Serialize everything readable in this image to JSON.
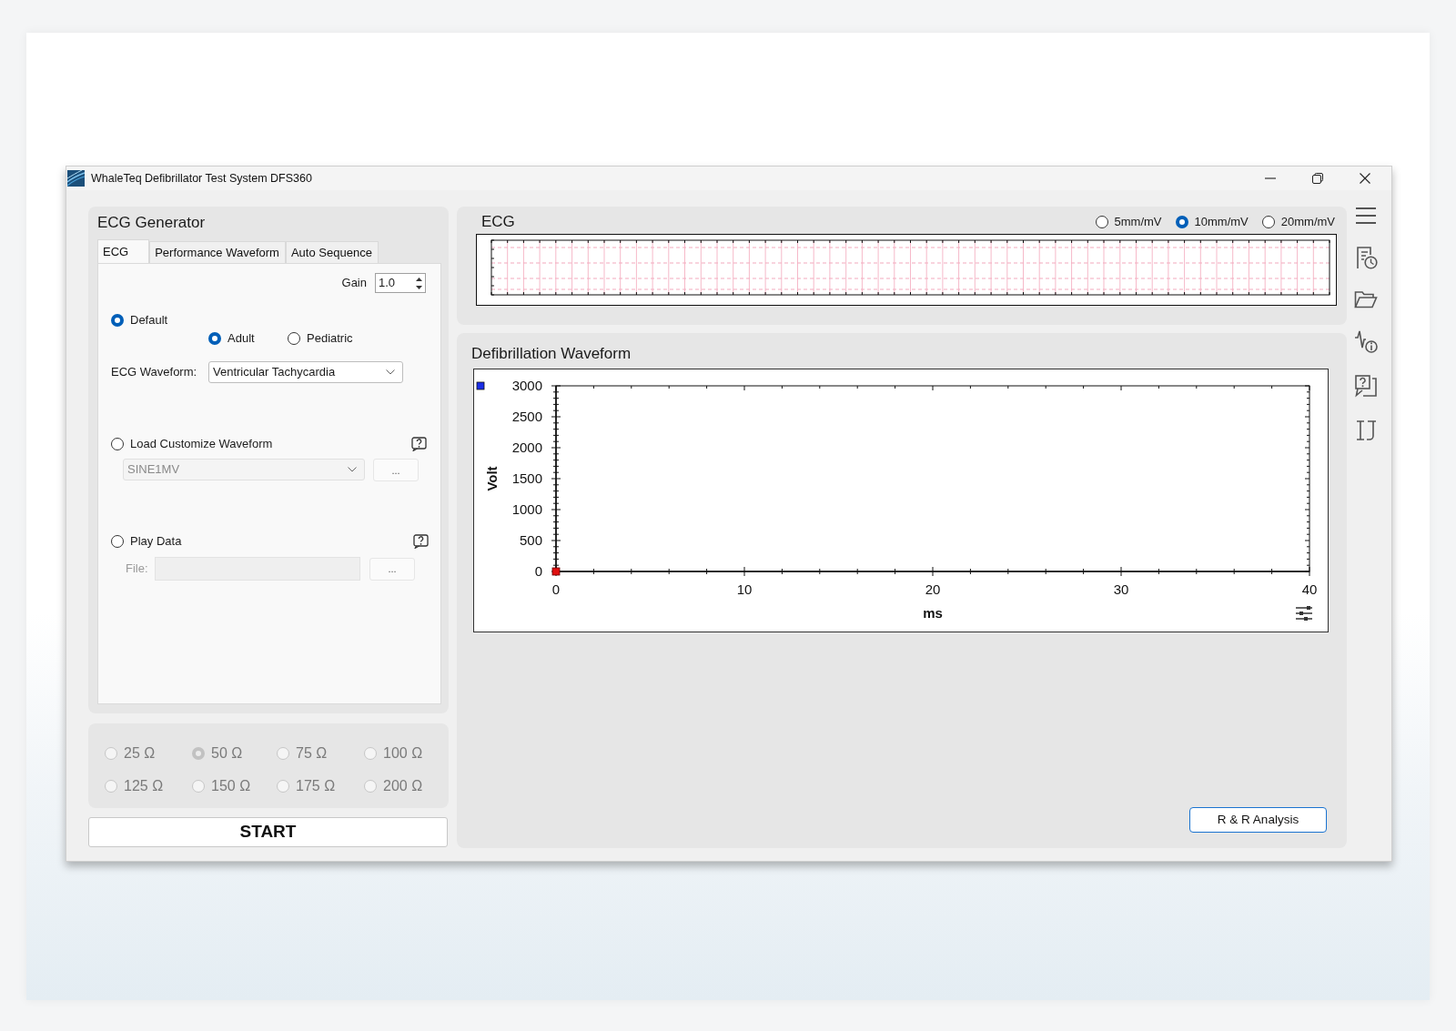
{
  "window": {
    "title": "WhaleTeq Defibrillator Test System DFS360"
  },
  "ecg_generator": {
    "title": "ECG Generator",
    "tabs": [
      {
        "label": "ECG",
        "selected": true
      },
      {
        "label": "Performance Waveform",
        "selected": false
      },
      {
        "label": "Auto Sequence",
        "selected": false
      }
    ],
    "gain": {
      "label": "Gain",
      "value": "1.0"
    },
    "sources": [
      {
        "kind": "default",
        "label": "Default",
        "selected": true,
        "patient_types": [
          {
            "label": "Adult",
            "selected": true
          },
          {
            "label": "Pediatric",
            "selected": false
          }
        ],
        "waveform": {
          "label": "ECG Waveform:",
          "value": "Ventricular Tachycardia"
        }
      },
      {
        "kind": "custom",
        "label": "Load Customize Waveform",
        "selected": false,
        "value": "SINE1MV",
        "browse_button": "..."
      },
      {
        "kind": "file",
        "label": "Play Data",
        "selected": false,
        "file_label": "File:",
        "browse_button": "..."
      }
    ]
  },
  "impedance": {
    "disabled": true,
    "options": [
      {
        "label": "25 Ω",
        "selected": false
      },
      {
        "label": "50 Ω",
        "selected": true
      },
      {
        "label": "75 Ω",
        "selected": false
      },
      {
        "label": "100 Ω",
        "selected": false
      },
      {
        "label": "125 Ω",
        "selected": false
      },
      {
        "label": "150 Ω",
        "selected": false
      },
      {
        "label": "175 Ω",
        "selected": false
      },
      {
        "label": "200 Ω",
        "selected": false
      }
    ]
  },
  "start_button": {
    "label": "START"
  },
  "ecg_panel": {
    "title": "ECG",
    "scales": [
      {
        "label": "5mm/mV",
        "selected": false
      },
      {
        "label": "10mm/mV",
        "selected": true
      },
      {
        "label": "20mm/mV",
        "selected": false
      }
    ]
  },
  "defibrillation_panel": {
    "title": "Defibrillation Waveform",
    "chart_data": {
      "type": "scatter",
      "xlabel": "ms",
      "ylabel": "Volt",
      "x": [
        0
      ],
      "series": [
        {
          "color": "#e01010",
          "values": [
            0
          ]
        }
      ],
      "xlim": [
        0,
        40
      ],
      "ylim": [
        0,
        3000
      ],
      "xticks": [
        0,
        10,
        20,
        30,
        40
      ],
      "yticks": [
        0,
        500,
        1000,
        1500,
        2000,
        2500,
        3000
      ]
    },
    "analysis_button": {
      "label": "R & R Analysis"
    }
  }
}
